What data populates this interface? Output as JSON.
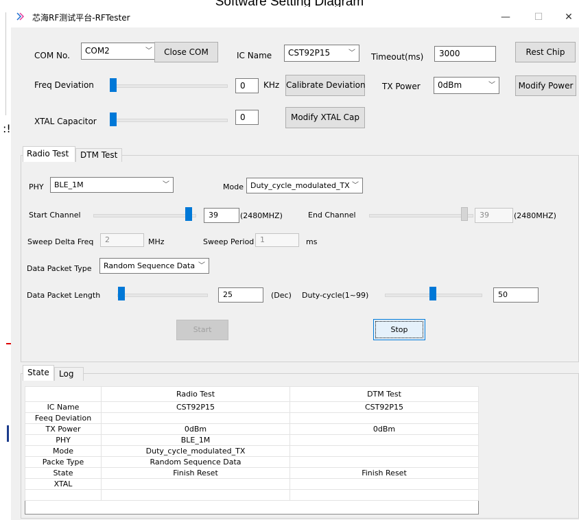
{
  "caption": "Software Setting Diagram",
  "window": {
    "title": "芯海RF测试平台-RFTester",
    "minimize": "—",
    "maximize": "☐",
    "close": "✕"
  },
  "top": {
    "com_label": "COM No.",
    "com_value": "COM2",
    "close_com": "Close COM",
    "ic_label": "IC Name",
    "ic_value": "CST92P15",
    "timeout_label": "Timeout(ms)",
    "timeout_value": "3000",
    "reset_chip": "Rest Chip",
    "freq_label": "Freq Deviation",
    "freq_value": "0",
    "freq_unit": "KHz",
    "calibrate": "Calibrate Deviation",
    "tx_label": "TX Power",
    "tx_value": "0dBm",
    "modify_power": "Modify Power",
    "xtal_label": "XTAL Capacitor",
    "xtal_value": "0",
    "modify_xtal": "Modify XTAL Cap"
  },
  "tabs": {
    "radio": "Radio Test",
    "dtm": "DTM Test"
  },
  "radio": {
    "phy_label": "PHY",
    "phy_value": "BLE_1M",
    "mode_label": "Mode",
    "mode_value": "Duty_cycle_modulated_TX",
    "start_label": "Start Channel",
    "start_value": "39",
    "start_freq": "(2480MHZ)",
    "end_label": "End Channel",
    "end_value": "39",
    "end_freq": "(2480MHZ)",
    "sweep_delta_label": "Sweep Delta Freq",
    "sweep_delta_value": "2",
    "sweep_delta_unit": "MHz",
    "sweep_period_label": "Sweep Period",
    "sweep_period_value": "1",
    "sweep_period_unit": "ms",
    "packet_type_label": "Data Packet Type",
    "packet_type_value": "Random Sequence Data",
    "packet_len_label": "Data Packet Length",
    "packet_len_value": "25",
    "packet_len_unit": "(Dec)",
    "duty_label": "Duty-cycle(1~99)",
    "duty_value": "50",
    "start_btn": "Start",
    "stop_btn": "Stop"
  },
  "state_tabs": {
    "state": "State",
    "log": "Log"
  },
  "state_table": {
    "headers": [
      "",
      "Radio Test",
      "DTM Test"
    ],
    "rows": [
      [
        "IC Name",
        "CST92P15",
        "CST92P15"
      ],
      [
        "Feeq Deviation",
        "",
        ""
      ],
      [
        "TX Power",
        "0dBm",
        "0dBm"
      ],
      [
        "PHY",
        "BLE_1M",
        ""
      ],
      [
        "Mode",
        "Duty_cycle_modulated_TX",
        ""
      ],
      [
        "Packe Type",
        "Random Sequence Data",
        ""
      ],
      [
        "State",
        "Finish Reset",
        "Finish Reset"
      ],
      [
        "XTAL",
        "",
        ""
      ],
      [
        "",
        "",
        ""
      ]
    ]
  },
  "colors": {
    "accent": "#0078d7",
    "panel": "#f0f0f0"
  },
  "icons": {
    "app": "play-arrows-icon",
    "dropdown": "chevron-down-icon"
  }
}
